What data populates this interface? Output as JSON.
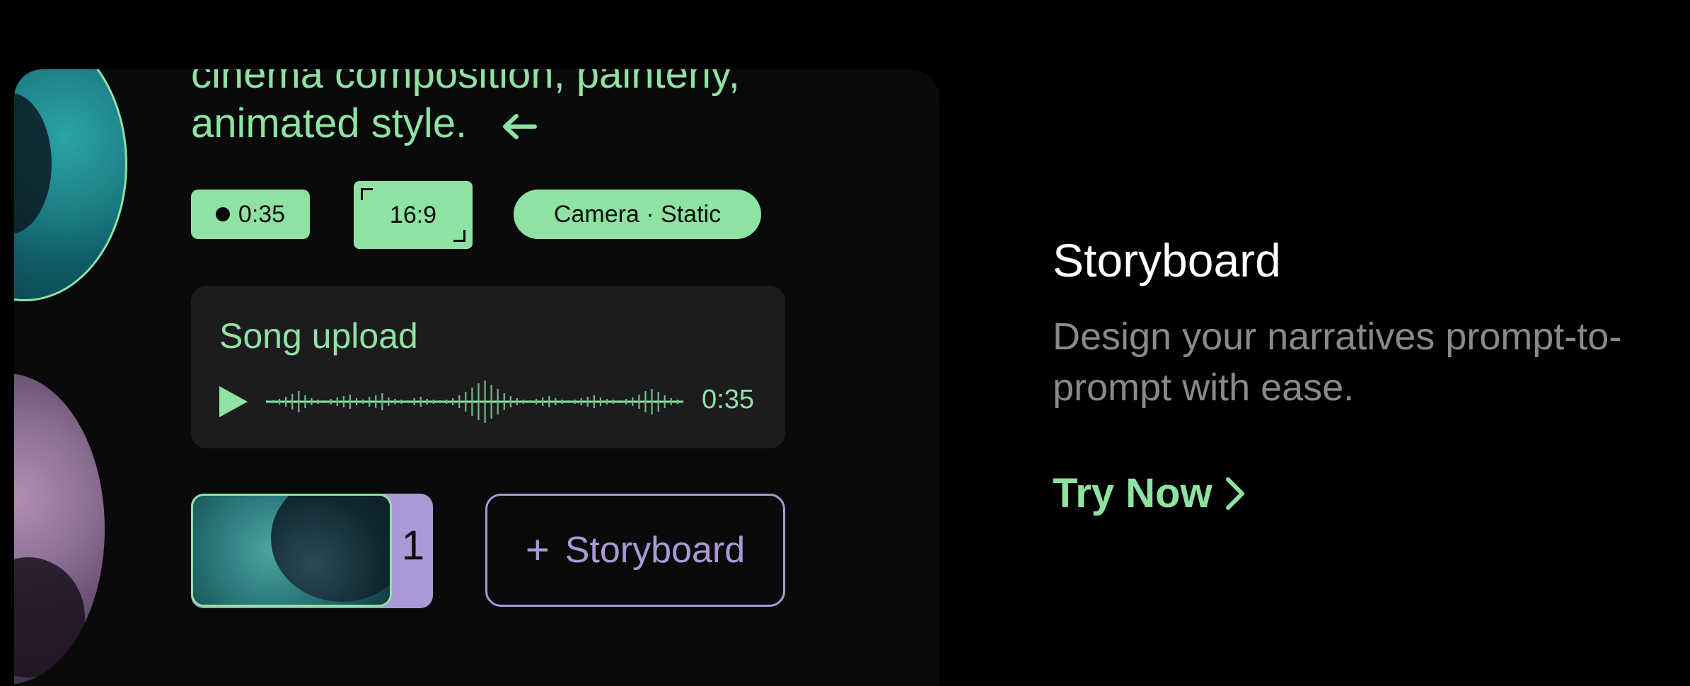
{
  "prompt": {
    "line1": "cinema composition, painterly,",
    "line2": "animated style."
  },
  "tags": {
    "duration": "0:35",
    "aspect_ratio": "16:9",
    "camera": "Camera · Static"
  },
  "song": {
    "title": "Song upload",
    "duration": "0:35"
  },
  "storyboard": {
    "count": "1",
    "add_label": "Storyboard",
    "add_icon": "+"
  },
  "feature": {
    "title": "Storyboard",
    "description": "Design your narratives prompt-to-prompt with ease.",
    "cta": "Try Now"
  },
  "colors": {
    "accent_green": "#8ee3a3",
    "accent_purple": "#a99ad6",
    "background": "#000000",
    "card": "#0a0a0a"
  }
}
